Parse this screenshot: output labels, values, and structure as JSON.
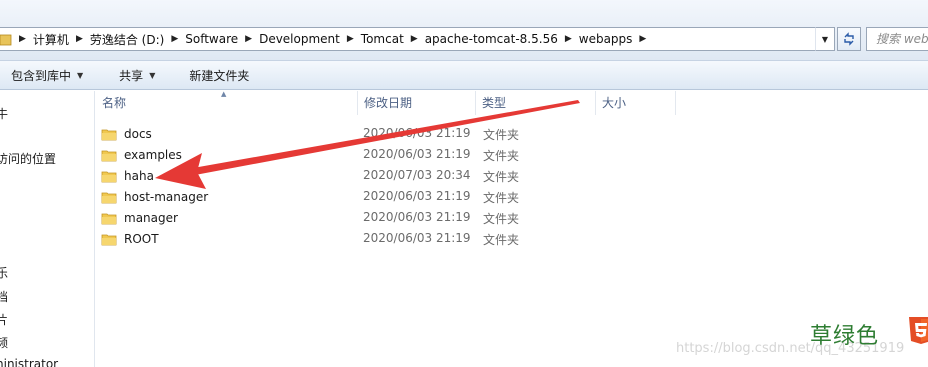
{
  "address_bar": {
    "crumbs": [
      "计算机",
      "劳逸结合 (D:)",
      "Software",
      "Development",
      "Tomcat",
      "apache-tomcat-8.5.56",
      "webapps"
    ],
    "search_placeholder": "搜索 web"
  },
  "toolbar": {
    "include_in_library": "包含到库中",
    "share": "共享",
    "new_folder": "新建文件夹"
  },
  "nav_pane": {
    "items": [
      "牛",
      "访问的位置",
      "乐",
      "档",
      "片",
      "频",
      "ninistrator"
    ]
  },
  "columns": {
    "name": "名称",
    "date_modified": "修改日期",
    "type": "类型",
    "size": "大小"
  },
  "files": [
    {
      "name": "docs",
      "date": "2020/06/03 21:19",
      "type": "文件夹"
    },
    {
      "name": "examples",
      "date": "2020/06/03 21:19",
      "type": "文件夹"
    },
    {
      "name": "haha",
      "date": "2020/07/03 20:34",
      "type": "文件夹"
    },
    {
      "name": "host-manager",
      "date": "2020/06/03 21:19",
      "type": "文件夹"
    },
    {
      "name": "manager",
      "date": "2020/06/03 21:19",
      "type": "文件夹"
    },
    {
      "name": "ROOT",
      "date": "2020/06/03 21:19",
      "type": "文件夹"
    }
  ],
  "watermark": {
    "brand": "草绿色",
    "url": "https://blog.csdn.net/qq_43251919"
  },
  "colors": {
    "header_text": "#4d6185",
    "annotation_arrow": "#e53935",
    "brand_green": "#2e7d32"
  }
}
